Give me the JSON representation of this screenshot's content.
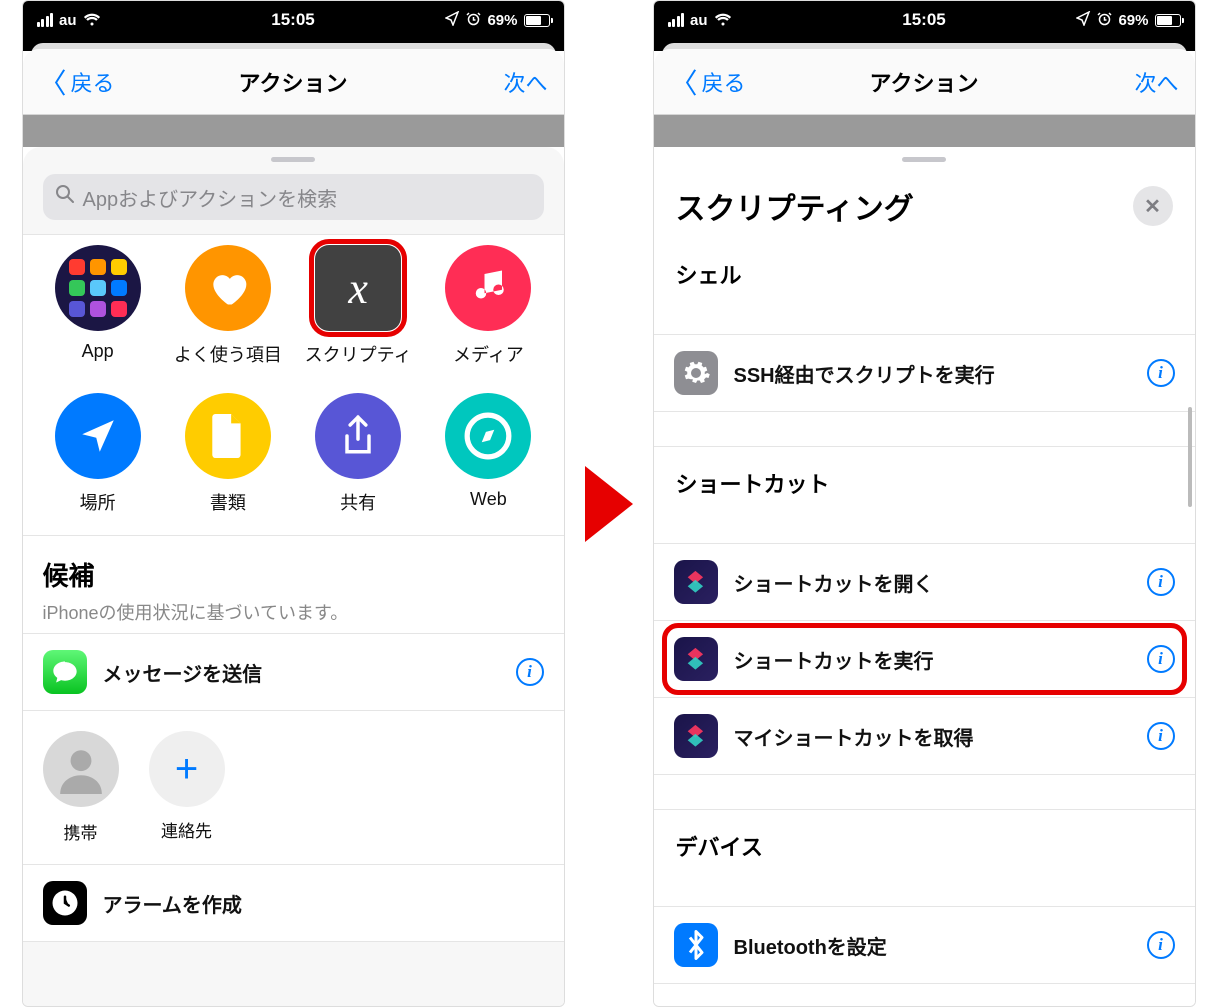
{
  "statusbar": {
    "carrier": "au",
    "time": "15:05",
    "battery": "69%"
  },
  "nav": {
    "back": "戻る",
    "title": "アクション",
    "next": "次へ"
  },
  "left": {
    "searchPlaceholder": "Appおよびアクションを検索",
    "categories": {
      "app": "App",
      "favorites": "よく使う項目",
      "scripting": "スクリプティ",
      "media": "メディア",
      "location": "場所",
      "documents": "書類",
      "sharing": "共有",
      "web": "Web"
    },
    "suggestions": {
      "title": "候補",
      "subtitle": "iPhoneの使用状況に基づいています。",
      "row1": "メッセージを送信",
      "contact1_line1": "",
      "contact1_line2": "携帯",
      "contact2": "連絡先",
      "row2": "アラームを作成"
    }
  },
  "right": {
    "sheetTitle": "スクリプティング",
    "groups": {
      "shell": "シェル",
      "ssh": "SSH経由でスクリプトを実行",
      "shortcuts": "ショートカット",
      "open": "ショートカットを開く",
      "run": "ショートカットを実行",
      "get": "マイショートカットを取得",
      "device": "デバイス",
      "bluetooth": "Bluetoothを設定"
    }
  }
}
